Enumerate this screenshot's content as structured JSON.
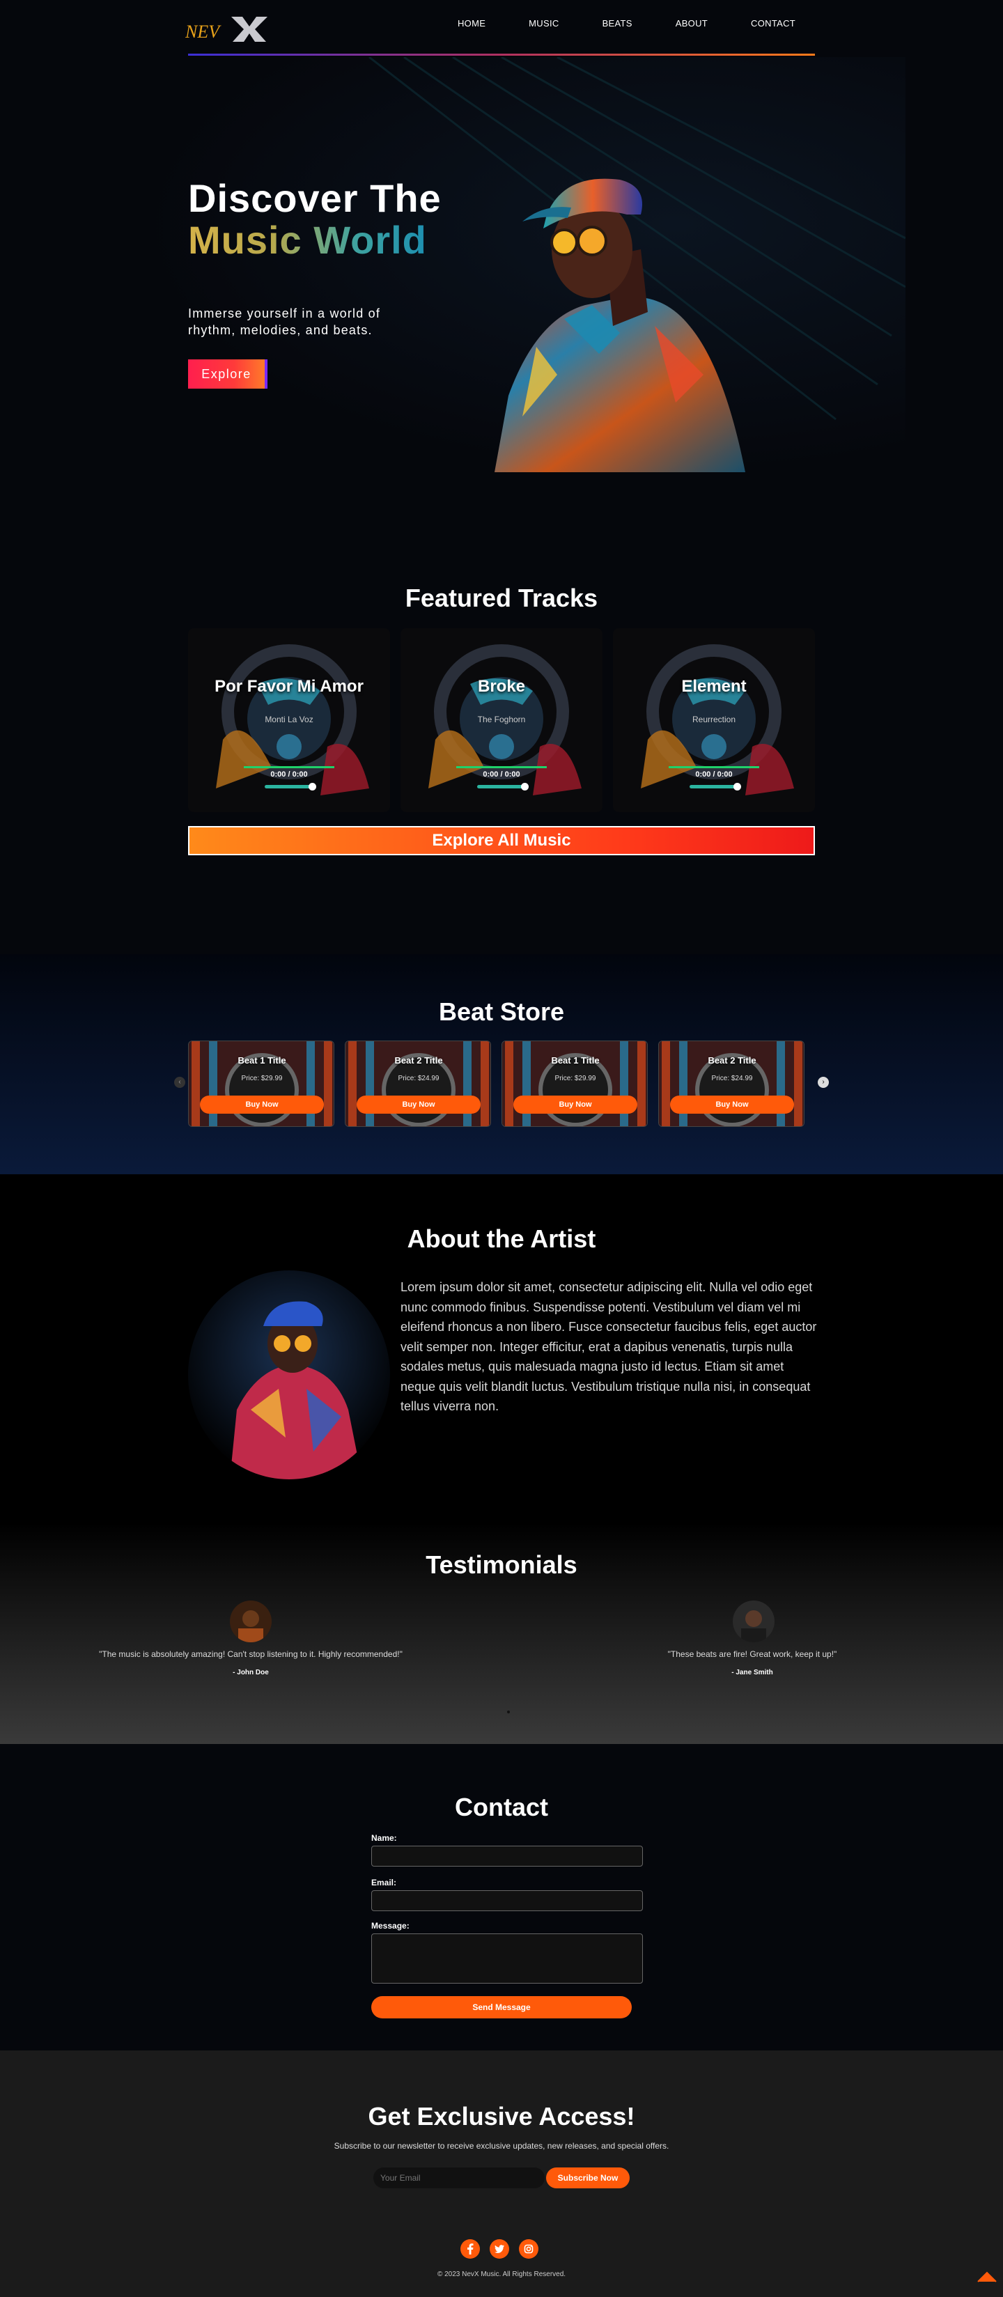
{
  "header": {
    "logo_text": "NEVX",
    "nav": [
      "HOME",
      "MUSIC",
      "BEATS",
      "ABOUT",
      "CONTACT"
    ]
  },
  "hero": {
    "title_line1": "Discover The",
    "title_line2": "Music World",
    "subtitle": "Immerse yourself in a world of rhythm, melodies, and beats.",
    "button": "Explore"
  },
  "featured": {
    "title": "Featured Tracks",
    "tracks": [
      {
        "title": "Por Favor Mi Amor",
        "artist": "Monti La Voz",
        "time": "0:00 / 0:00"
      },
      {
        "title": "Broke",
        "artist": "The Foghorn",
        "time": "0:00 / 0:00"
      },
      {
        "title": "Element",
        "artist": "Reurrection",
        "time": "0:00 / 0:00"
      }
    ],
    "explore_all": "Explore All Music"
  },
  "beats": {
    "title": "Beat Store",
    "items": [
      {
        "title": "Beat 1 Title",
        "price": "Price: $29.99",
        "button": "Buy Now"
      },
      {
        "title": "Beat 2 Title",
        "price": "Price: $24.99",
        "button": "Buy Now"
      },
      {
        "title": "Beat 1 Title",
        "price": "Price: $29.99",
        "button": "Buy Now"
      },
      {
        "title": "Beat 2 Title",
        "price": "Price: $24.99",
        "button": "Buy Now"
      }
    ]
  },
  "about": {
    "title": "About the Artist",
    "text": "Lorem ipsum dolor sit amet, consectetur adipiscing elit. Nulla vel odio eget nunc commodo finibus. Suspendisse potenti. Vestibulum vel diam vel mi eleifend rhoncus a non libero. Fusce consectetur faucibus felis, eget auctor velit semper non. Integer efficitur, erat a dapibus venenatis, turpis nulla sodales metus, quis malesuada magna justo id lectus. Etiam sit amet neque quis velit blandit luctus. Vestibulum tristique nulla nisi, in consequat tellus viverra non."
  },
  "testimonials": {
    "title": "Testimonials",
    "items": [
      {
        "quote": "\"The music is absolutely amazing! Can't stop listening to it. Highly recommended!\"",
        "name": "- John Doe"
      },
      {
        "quote": "\"These beats are fire! Great work, keep it up!\"",
        "name": "- Jane Smith"
      }
    ]
  },
  "contact": {
    "title": "Contact",
    "name_label": "Name:",
    "email_label": "Email:",
    "message_label": "Message:",
    "button": "Send Message"
  },
  "newsletter": {
    "title": "Get Exclusive Access!",
    "subtitle": "Subscribe to our newsletter to receive exclusive updates, new releases, and special offers.",
    "placeholder": "Your Email",
    "button": "Subscribe Now"
  },
  "footer": {
    "copyright": "© 2023 NevX Music. All Rights Reserved.",
    "social": [
      "facebook-icon",
      "twitter-icon",
      "instagram-icon"
    ]
  },
  "colors": {
    "accent": "#ff5a0a",
    "background": "#05070c"
  }
}
